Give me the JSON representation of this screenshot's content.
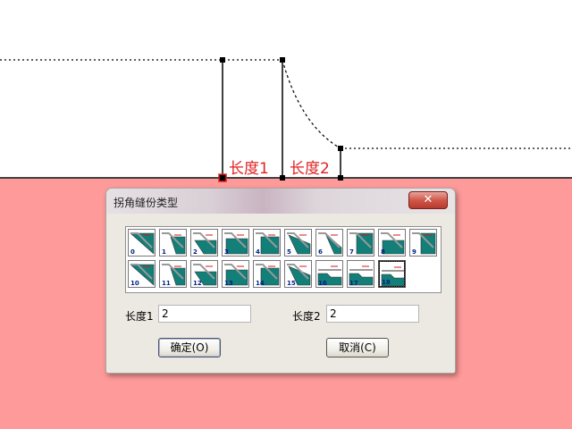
{
  "canvas": {
    "background_color": "#ffffff",
    "ground_color": "#ff9a9a",
    "line_color": "#000000",
    "label_color": "#e02020",
    "label1": "长度1",
    "label2": "长度2"
  },
  "dialog": {
    "title": "拐角缝份类型",
    "close_icon": "close-x-icon",
    "corner_types": [
      {
        "number": "0"
      },
      {
        "number": "1"
      },
      {
        "number": "2"
      },
      {
        "number": "3"
      },
      {
        "number": "4"
      },
      {
        "number": "5"
      },
      {
        "number": "6"
      },
      {
        "number": "7"
      },
      {
        "number": "8"
      },
      {
        "number": "9"
      },
      {
        "number": "10"
      },
      {
        "number": "11"
      },
      {
        "number": "12"
      },
      {
        "number": "13"
      },
      {
        "number": "14"
      },
      {
        "number": "15"
      },
      {
        "number": "16"
      },
      {
        "number": "17"
      },
      {
        "number": "18"
      }
    ],
    "selected_type": "18",
    "length1": {
      "label": "长度1",
      "value": "2"
    },
    "length2": {
      "label": "长度2",
      "value": "2"
    },
    "ok_label": "确定(O)",
    "cancel_label": "取消(C)"
  }
}
